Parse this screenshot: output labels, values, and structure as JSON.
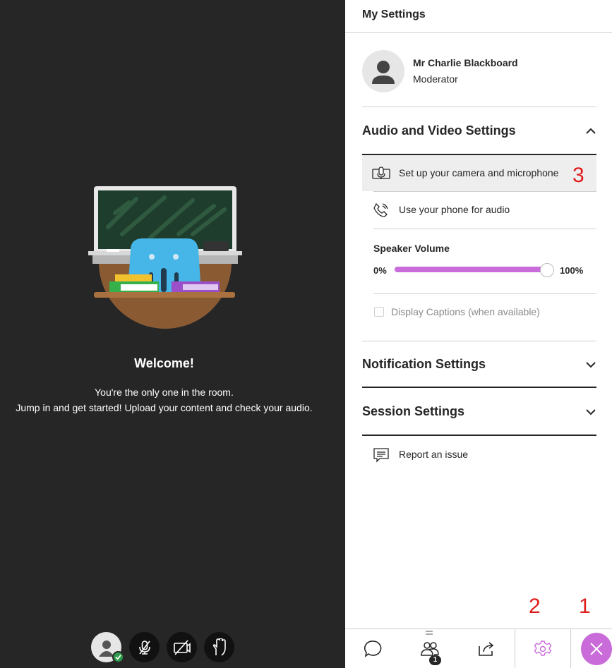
{
  "stage": {
    "welcome_title": "Welcome!",
    "welcome_line1": "You're the only one in the room.",
    "welcome_line2": "Jump in and get started! Upload your content and check your audio."
  },
  "controls": [
    {
      "icon": "avatar-icon"
    },
    {
      "icon": "mic-off-icon"
    },
    {
      "icon": "camera-off-icon"
    },
    {
      "icon": "raise-hand-icon"
    }
  ],
  "panel": {
    "title": "My Settings",
    "profile": {
      "name": "Mr Charlie Blackboard",
      "role": "Moderator"
    },
    "audio_video": {
      "title": "Audio and Video Settings",
      "camera_label": "Set up your camera and microphone",
      "phone_label": "Use your phone for audio",
      "volume_label": "Speaker Volume",
      "volume_min": "0%",
      "volume_max": "100%",
      "volume_level": 1.0,
      "captions_label": "Display Captions (when available)"
    },
    "notification_title": "Notification Settings",
    "session_title": "Session Settings",
    "report_label": "Report an issue"
  },
  "bottom_nav": {
    "attendee_count": "1",
    "items": [
      "chat-icon",
      "attendees-icon",
      "share-content-icon",
      "settings-icon",
      "close-icon"
    ]
  },
  "annotations": {
    "a1": "1",
    "a2": "2",
    "a3": "3"
  },
  "colors": {
    "accent": "#c96bd9",
    "stage_bg": "#262626",
    "annotation": "#e01b1b",
    "status_ok": "#2e9a4b"
  }
}
